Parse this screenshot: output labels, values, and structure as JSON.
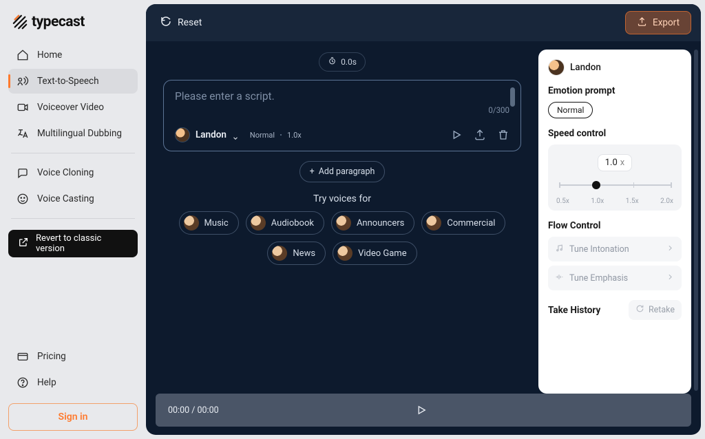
{
  "brand": {
    "name": "typecast"
  },
  "sidebar": {
    "items": [
      {
        "label": "Home"
      },
      {
        "label": "Text-to-Speech"
      },
      {
        "label": "Voiceover Video"
      },
      {
        "label": "Multilingual Dubbing"
      },
      {
        "label": "Voice Cloning"
      },
      {
        "label": "Voice Casting"
      }
    ],
    "revert_label": "Revert to classic version",
    "pricing_label": "Pricing",
    "help_label": "Help",
    "signin_label": "Sign in"
  },
  "topbar": {
    "reset_label": "Reset",
    "export_label": "Export"
  },
  "stage": {
    "timer_text": "0.0s",
    "script_placeholder": "Please enter a script.",
    "char_count": "0/300",
    "voice_name": "Landon",
    "emotion_display": "Normal",
    "speed_display": "1.0x",
    "add_paragraph_label": "Add paragraph",
    "try_voices_title": "Try voices for",
    "voice_options": [
      {
        "label": "Music"
      },
      {
        "label": "Audiobook"
      },
      {
        "label": "Announcers"
      },
      {
        "label": "Commercial"
      },
      {
        "label": "News"
      },
      {
        "label": "Video Game"
      }
    ]
  },
  "panel": {
    "voice_name": "Landon",
    "emotion_title": "Emotion prompt",
    "emotion_value": "Normal",
    "speed_title": "Speed control",
    "speed_value": "1.0",
    "speed_unit": "x",
    "speed_ticks": [
      "0.5x",
      "1.0x",
      "1.5x",
      "2.0x"
    ],
    "flow_title": "Flow Control",
    "intonation_label": "Tune Intonation",
    "emphasis_label": "Tune Emphasis",
    "history_title": "Take History",
    "retake_label": "Retake"
  },
  "playbar": {
    "time_text": "00:00 / 00:00"
  },
  "colors": {
    "accent": "#ff7a2e",
    "bg_dark": "#0d1a2d"
  }
}
